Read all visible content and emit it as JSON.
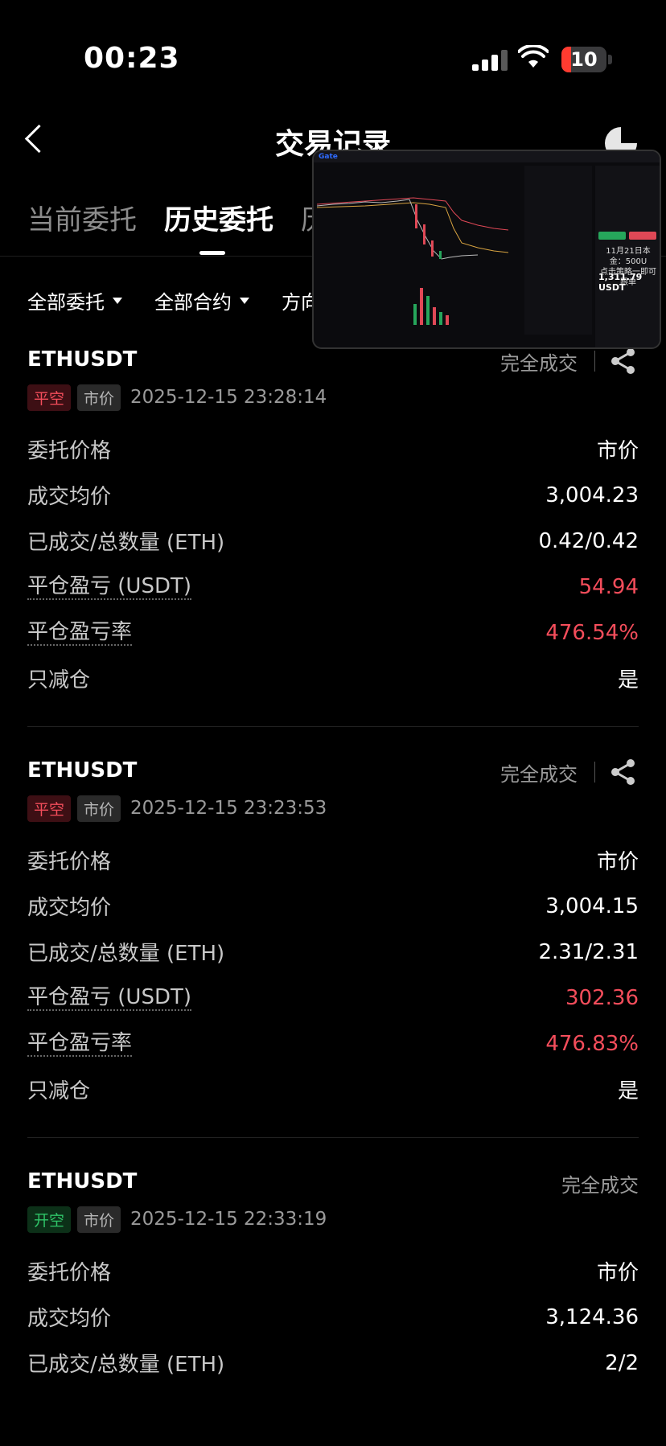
{
  "status_bar": {
    "time": "00:23",
    "battery": "10"
  },
  "header": {
    "title": "交易记录"
  },
  "tabs": [
    {
      "label": "当前委托",
      "active": false
    },
    {
      "label": "历史委托",
      "active": true
    },
    {
      "label": "历",
      "active": false
    }
  ],
  "filters": [
    {
      "label": "全部委托"
    },
    {
      "label": "全部合约"
    },
    {
      "label": "方向"
    }
  ],
  "orders": [
    {
      "symbol": "ETHUSDT",
      "status": "完全成交",
      "side": "平空",
      "type": "市价",
      "time": "2025-12-15 23:28:14",
      "rows": [
        {
          "label": "委托价格",
          "value": "市价"
        },
        {
          "label": "成交均价",
          "value": "3,004.23"
        },
        {
          "label": "已成交/总数量 (ETH)",
          "value": "0.42/0.42"
        },
        {
          "label": "平仓盈亏 (USDT)",
          "value": "54.94"
        },
        {
          "label": "平仓盈亏率",
          "value": "476.54%"
        },
        {
          "label": "只减仓",
          "value": "是"
        }
      ]
    },
    {
      "symbol": "ETHUSDT",
      "status": "完全成交",
      "side": "平空",
      "type": "市价",
      "time": "2025-12-15 23:23:53",
      "rows": [
        {
          "label": "委托价格",
          "value": "市价"
        },
        {
          "label": "成交均价",
          "value": "3,004.15"
        },
        {
          "label": "已成交/总数量 (ETH)",
          "value": "2.31/2.31"
        },
        {
          "label": "平仓盈亏 (USDT)",
          "value": "302.36"
        },
        {
          "label": "平仓盈亏率",
          "value": "476.83%"
        },
        {
          "label": "只减仓",
          "value": "是"
        }
      ]
    },
    {
      "symbol": "ETHUSDT",
      "status": "完全成交",
      "side": "开空",
      "type": "市价",
      "time": "2025-12-15 22:33:19",
      "rows": [
        {
          "label": "委托价格",
          "value": "市价"
        },
        {
          "label": "成交均价",
          "value": "3,124.36"
        },
        {
          "label": "已成交/总数量 (ETH)",
          "value": "2/2"
        }
      ]
    }
  ],
  "overlay": {
    "logo": "Gate",
    "note_line1": "11月21日本金：500U",
    "note_line2": "点击策略一即可跟单",
    "balance": "1,311.79 USDT"
  },
  "colors": {
    "negative_red": "#f44d5b",
    "positive_green": "#2fc468"
  }
}
